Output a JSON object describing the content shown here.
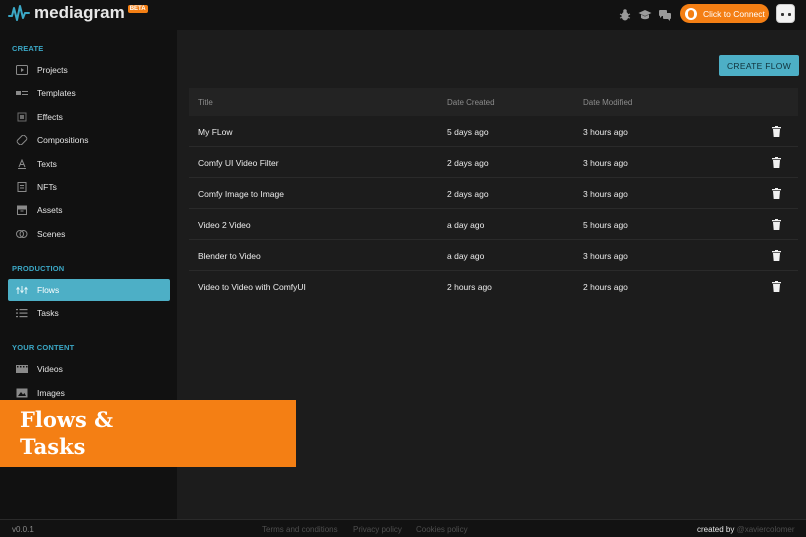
{
  "app": {
    "name": "mediagram",
    "badge": "BETA",
    "connect_label": "Click to Connect"
  },
  "sidebar": {
    "sections": [
      {
        "label": "CREATE"
      },
      {
        "label": "PRODUCTION"
      },
      {
        "label": "YOUR CONTENT"
      }
    ],
    "items": [
      {
        "label": "Projects",
        "icon": "play-screen-icon"
      },
      {
        "label": "Templates",
        "icon": "template-icon"
      },
      {
        "label": "Effects",
        "icon": "effects-icon"
      },
      {
        "label": "Compositions",
        "icon": "compositions-icon"
      },
      {
        "label": "Texts",
        "icon": "text-icon"
      },
      {
        "label": "NFTs",
        "icon": "nft-icon"
      },
      {
        "label": "Assets",
        "icon": "assets-icon"
      },
      {
        "label": "Scenes",
        "icon": "scenes-icon"
      },
      {
        "label": "Flows",
        "icon": "flows-icon",
        "active": true
      },
      {
        "label": "Tasks",
        "icon": "tasks-icon"
      },
      {
        "label": "Videos",
        "icon": "video-icon"
      },
      {
        "label": "Images",
        "icon": "image-icon"
      }
    ]
  },
  "main": {
    "create_flow_label": "CREATE FLOW",
    "table": {
      "headers": {
        "title": "Title",
        "created": "Date Created",
        "modified": "Date Modified"
      },
      "rows": [
        {
          "title": "My FLow",
          "created": "5 days ago",
          "modified": "3 hours ago"
        },
        {
          "title": "Comfy UI Video Filter",
          "created": "2 days ago",
          "modified": "3 hours ago"
        },
        {
          "title": "Comfy Image to Image",
          "created": "2 days ago",
          "modified": "3 hours ago"
        },
        {
          "title": "Video 2 Video",
          "created": "a day ago",
          "modified": "5 hours ago"
        },
        {
          "title": "Blender to Video",
          "created": "a day ago",
          "modified": "3 hours ago"
        },
        {
          "title": "Video to Video with ComfyUI",
          "created": "2 hours ago",
          "modified": "2 hours ago"
        }
      ]
    }
  },
  "banner": {
    "line1": "Flows &",
    "line2": "Tasks"
  },
  "footer": {
    "version": "v0.0.1",
    "terms": "Terms and conditions",
    "privacy": "Privacy policy",
    "cookies": "Cookies policy",
    "created_by": "created by",
    "author": "@xaviercolomer"
  },
  "colors": {
    "accent": "#4dafc6",
    "brand_orange": "#f47f14",
    "background": "#1c1c1c",
    "sidebar": "#111111"
  },
  "top_icons": [
    "bug-icon",
    "graduation-cap-icon",
    "chat-icon"
  ]
}
